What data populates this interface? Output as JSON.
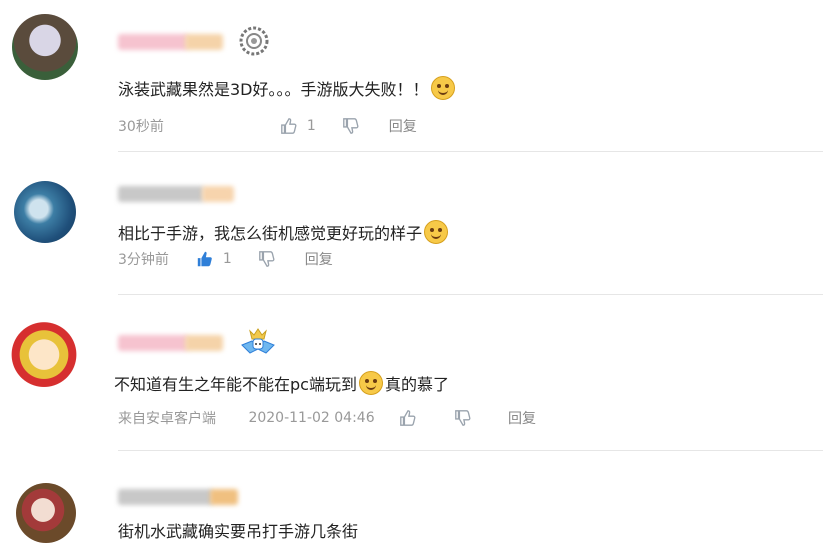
{
  "comments": [
    {
      "text_before": "泳装武藏果然是3D好。。。手游版大失败！！",
      "text_after": "",
      "emoji": "sweat-smile-emoji",
      "source": "",
      "time": "30秒前",
      "likes": "1",
      "liked": false,
      "reply_label": "回复",
      "name_colors": [
        "#f6c3cf",
        "#f5d3a9"
      ],
      "badge_icon": "gear-badge-icon"
    },
    {
      "text_before": "相比于手游，我怎么街机感觉更好玩的样子",
      "text_after": "",
      "emoji": "shy-emoji",
      "source": "",
      "time": "3分钟前",
      "likes": "1",
      "liked": true,
      "reply_label": "回复",
      "name_colors": [
        "#c8c8c8",
        "#f7d4ad"
      ],
      "badge_icon": ""
    },
    {
      "text_before": "不知道有生之年能不能在pc端玩到",
      "text_after": "真的慕了",
      "emoji": "envy-emoji",
      "source": "来自安卓客户端",
      "time": "2020-11-02 04:46",
      "likes": "",
      "liked": false,
      "reply_label": "回复",
      "name_colors": [
        "#f6c3cf",
        "#f5d3a9"
      ],
      "badge_icon": "crown-badge-icon"
    },
    {
      "text_before": "街机水武藏确实要吊打手游几条街",
      "text_after": "",
      "emoji": "",
      "source": "",
      "time": "",
      "likes": "",
      "liked": false,
      "reply_label": "",
      "name_colors": [
        "#c8c8c8",
        "#f0c080"
      ],
      "badge_icon": ""
    }
  ],
  "colors": {
    "liked_blue": "#2f7fd8",
    "icon_gray": "#9aa3ad",
    "divider": "#e6e6e6"
  }
}
